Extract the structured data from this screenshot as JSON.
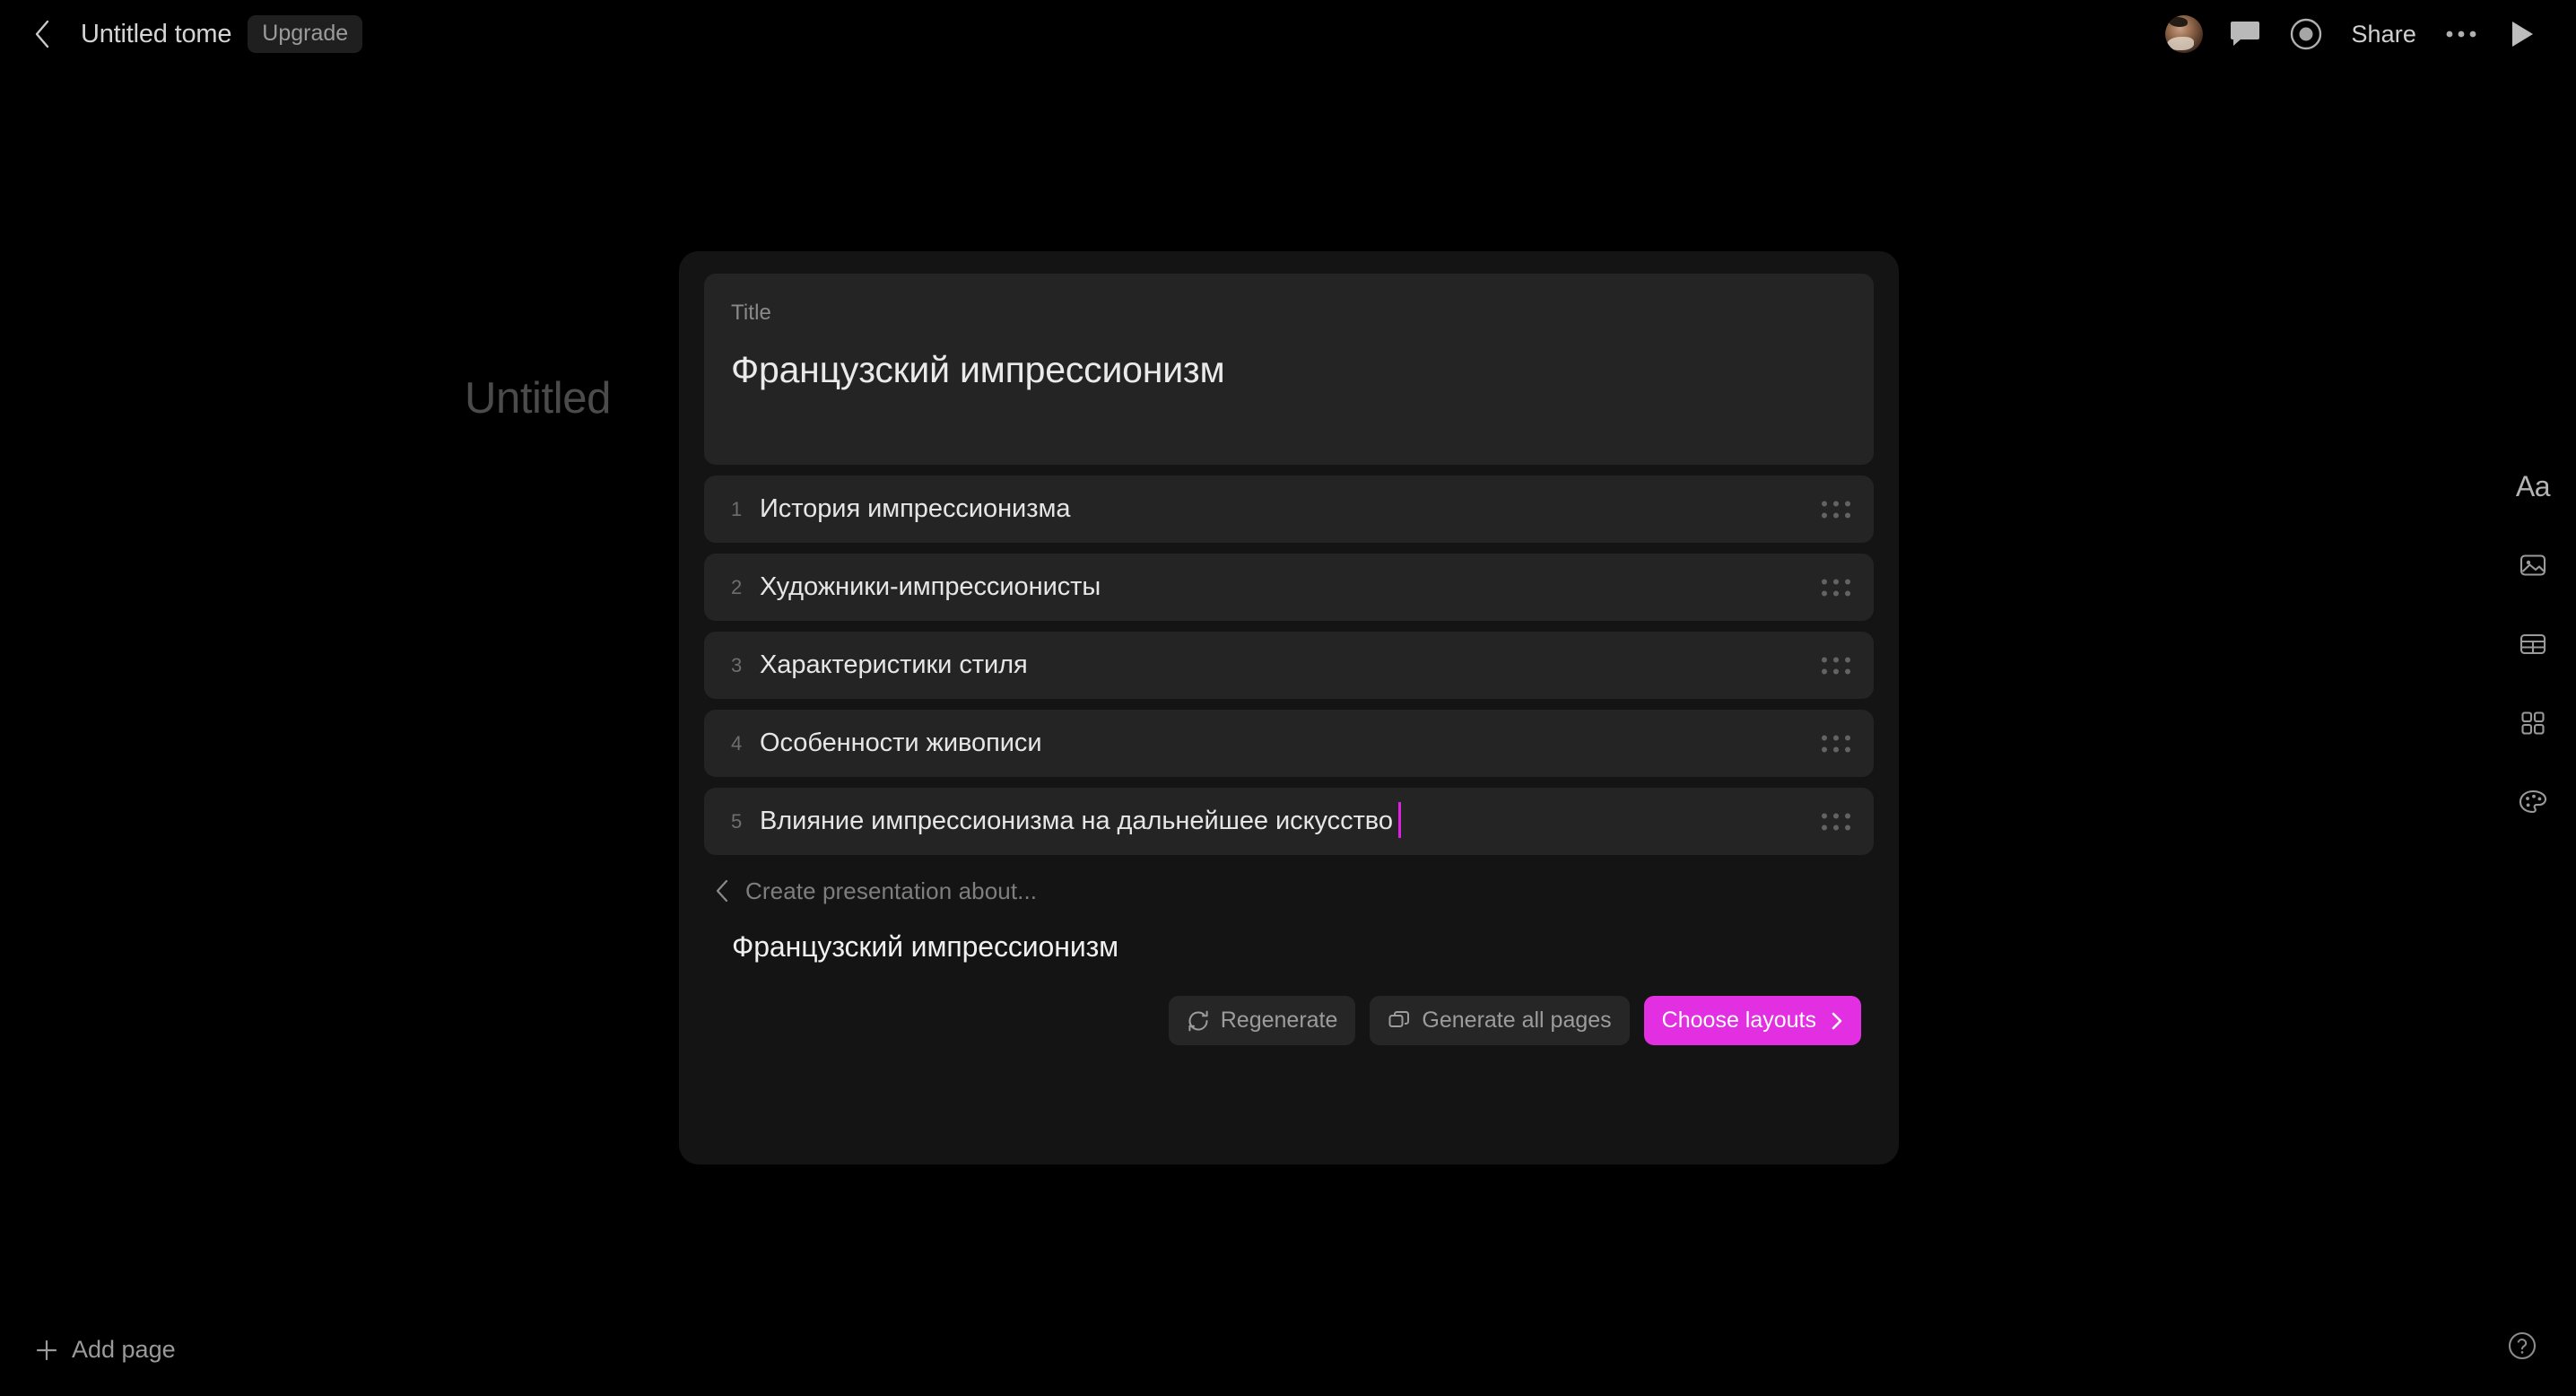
{
  "header": {
    "back_icon": "chevron-left-icon",
    "doc_title": "Untitled tome",
    "upgrade_label": "Upgrade",
    "avatar_name": "user-avatar",
    "comment_icon": "comment-icon",
    "record_icon": "record-icon",
    "share_label": "Share",
    "more_icon": "ellipsis-icon",
    "present_icon": "play-icon"
  },
  "canvas": {
    "page_placeholder": "Untitled"
  },
  "outline": {
    "title_label": "Title",
    "title_value": "Французский импрессионизм",
    "items": [
      {
        "num": "1",
        "text": "История импрессионизма"
      },
      {
        "num": "2",
        "text": "Художники-импрессионисты"
      },
      {
        "num": "3",
        "text": "Характеристики стиля"
      },
      {
        "num": "4",
        "text": "Особенности живописи"
      },
      {
        "num": "5",
        "text": "Влияние импрессионизма на дальнейшее искусство"
      }
    ],
    "caret_item_index": 4,
    "caret_color": "#e020e0"
  },
  "prompt": {
    "back_icon": "chevron-left-icon",
    "breadcrumb": "Create presentation about...",
    "value": "Французский импрессионизм"
  },
  "actions": {
    "regenerate": {
      "label": "Regenerate",
      "icon": "refresh-icon"
    },
    "generate_all": {
      "label": "Generate all pages",
      "icon": "copy-pages-icon"
    },
    "choose_layouts": {
      "label": "Choose layouts",
      "icon": "chevron-right-icon",
      "color": "#e22fe2"
    }
  },
  "right_rail": {
    "items": [
      {
        "name": "text-tool",
        "label": "Aa"
      },
      {
        "name": "image-tool",
        "label": ""
      },
      {
        "name": "table-tool",
        "label": ""
      },
      {
        "name": "layout-tool",
        "label": ""
      },
      {
        "name": "theme-tool",
        "label": ""
      }
    ]
  },
  "footer": {
    "add_page_label": "Add page",
    "add_page_icon": "plus-icon",
    "help_icon": "help-circle-icon"
  }
}
